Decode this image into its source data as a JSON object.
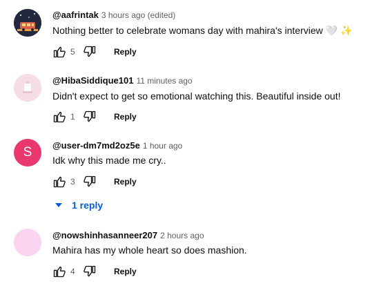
{
  "comments": [
    {
      "author": "@aafrintak",
      "time": "3 hours ago (edited)",
      "text": "Nothing better to celebrate womans day with mahira's interview 🤍 ✨",
      "likes": "5",
      "reply_label": "Reply",
      "avatar": {
        "type": "image",
        "color": "#2a2f45"
      }
    },
    {
      "author": "@HibaSiddique101",
      "time": "11 minutes ago",
      "text": "Didn't expect to get so emotional watching this. Beautiful inside out!",
      "likes": "1",
      "reply_label": "Reply",
      "avatar": {
        "type": "image",
        "color": "#f3d9e1"
      }
    },
    {
      "author": "@user-dm7md2oz5e",
      "time": "1 hour ago",
      "text": "Idk why this made me cry..",
      "likes": "3",
      "reply_label": "Reply",
      "avatar": {
        "type": "letter",
        "letter": "S",
        "color": "#e8386d"
      }
    },
    {
      "author": "@nowshinhasanneer207",
      "time": "2 hours ago",
      "text": "Mahira has my whole heart so does mashion.",
      "likes": "4",
      "reply_label": "Reply",
      "avatar": {
        "type": "solid",
        "color": "#f9d3f0"
      }
    }
  ],
  "replies_toggle": {
    "label": "1 reply",
    "icon": "caret-down-icon",
    "color": "#065fd4"
  },
  "icons": {
    "like": "thumbs-up-icon",
    "dislike": "thumbs-down-icon"
  }
}
